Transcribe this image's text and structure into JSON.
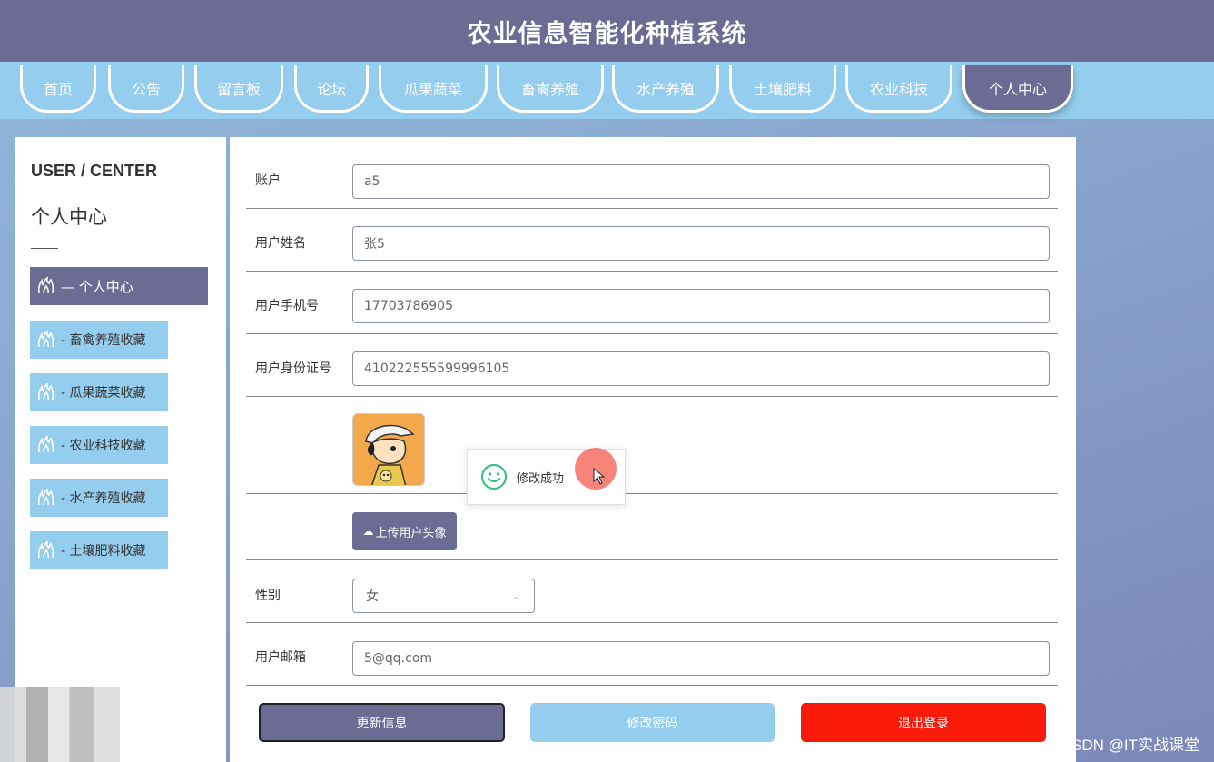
{
  "header": {
    "title": "农业信息智能化种植系统"
  },
  "nav": {
    "items": [
      {
        "label": "首页"
      },
      {
        "label": "公告"
      },
      {
        "label": "留言板"
      },
      {
        "label": "论坛"
      },
      {
        "label": "瓜果蔬菜"
      },
      {
        "label": "畜禽养殖"
      },
      {
        "label": "水产养殖"
      },
      {
        "label": "土壤肥料"
      },
      {
        "label": "农业科技"
      },
      {
        "label": "个人中心",
        "active": true
      }
    ]
  },
  "sidebar": {
    "title_en": "USER / CENTER",
    "title_cn": "个人中心",
    "items": [
      {
        "label": "— 个人中心",
        "active": true
      },
      {
        "label": "- 畜禽养殖收藏"
      },
      {
        "label": "- 瓜果蔬菜收藏"
      },
      {
        "label": "- 农业科技收藏"
      },
      {
        "label": "- 水产养殖收藏"
      },
      {
        "label": "- 土壤肥料收藏"
      }
    ]
  },
  "form": {
    "account": {
      "label": "账户",
      "value": "a5"
    },
    "name": {
      "label": "用户姓名",
      "value": "张5"
    },
    "phone": {
      "label": "用户手机号",
      "value": "17703786905"
    },
    "id_card": {
      "label": "用户身份证号",
      "value": "410222555599996105"
    },
    "upload_label": "上传用户头像",
    "gender": {
      "label": "性别",
      "value": "女"
    },
    "email": {
      "label": "用户邮箱",
      "value": "5@qq.com"
    }
  },
  "toast": {
    "message": "修改成功"
  },
  "actions": {
    "update": "更新信息",
    "change_password": "修改密码",
    "logout": "退出登录"
  },
  "watermark": "CSDN @IT实战课堂",
  "colors": {
    "primary": "#6b6b93",
    "nav_bg": "#95cdee",
    "logout": "#fa1a0a"
  }
}
